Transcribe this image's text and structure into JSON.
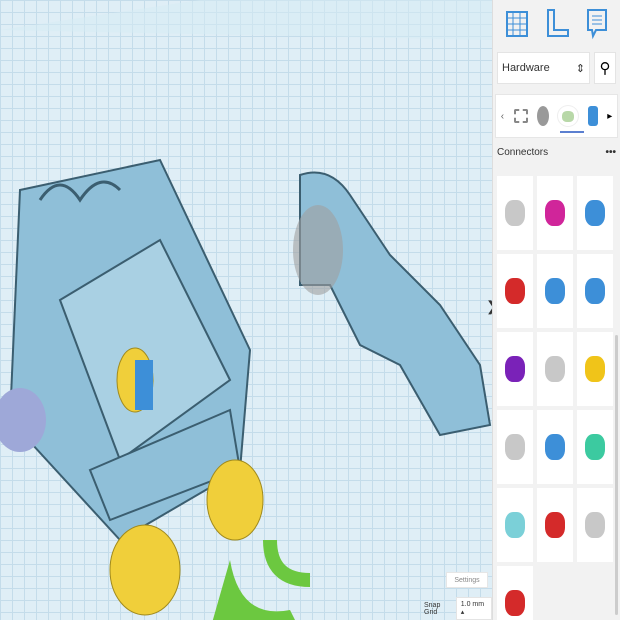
{
  "toolbar": {
    "icons": [
      "grid-icon",
      "ruler-icon",
      "notes-icon"
    ]
  },
  "library": {
    "selected": "Hardware",
    "search_icon": "search-icon",
    "category_icons": [
      "basic-shapes",
      "tools",
      "connectors",
      "parts"
    ],
    "section_title": "Connectors",
    "more": "•••",
    "shapes": [
      {
        "name": "connector-grey",
        "color": "#c8c8c8"
      },
      {
        "name": "connector-magenta",
        "color": "#d0259a"
      },
      {
        "name": "connector-blue-pin",
        "color": "#3d8fd8"
      },
      {
        "name": "connector-red",
        "color": "#d42a2a"
      },
      {
        "name": "connector-blue-bone",
        "color": "#3d8fd8"
      },
      {
        "name": "connector-blue-pin-2",
        "color": "#3d8fd8"
      },
      {
        "name": "connector-purple",
        "color": "#7a22b8"
      },
      {
        "name": "connector-grey-ball",
        "color": "#c8c8c8"
      },
      {
        "name": "connector-yellow",
        "color": "#f0c419"
      },
      {
        "name": "connector-grey-egg",
        "color": "#c8c8c8"
      },
      {
        "name": "connector-blue-clip",
        "color": "#3d8fd8"
      },
      {
        "name": "connector-teal",
        "color": "#3ccaa0"
      },
      {
        "name": "connector-cyan",
        "color": "#7bd0d8"
      },
      {
        "name": "connector-red-tall",
        "color": "#d42a2a"
      },
      {
        "name": "connector-grey-egg-2",
        "color": "#c8c8c8"
      },
      {
        "name": "connector-red-hex",
        "color": "#d42a2a"
      }
    ]
  },
  "canvas": {
    "settings": "Settings",
    "snap_label": "Snap Grid",
    "snap_value": "1.0 mm ▴",
    "collapse": "❯"
  }
}
